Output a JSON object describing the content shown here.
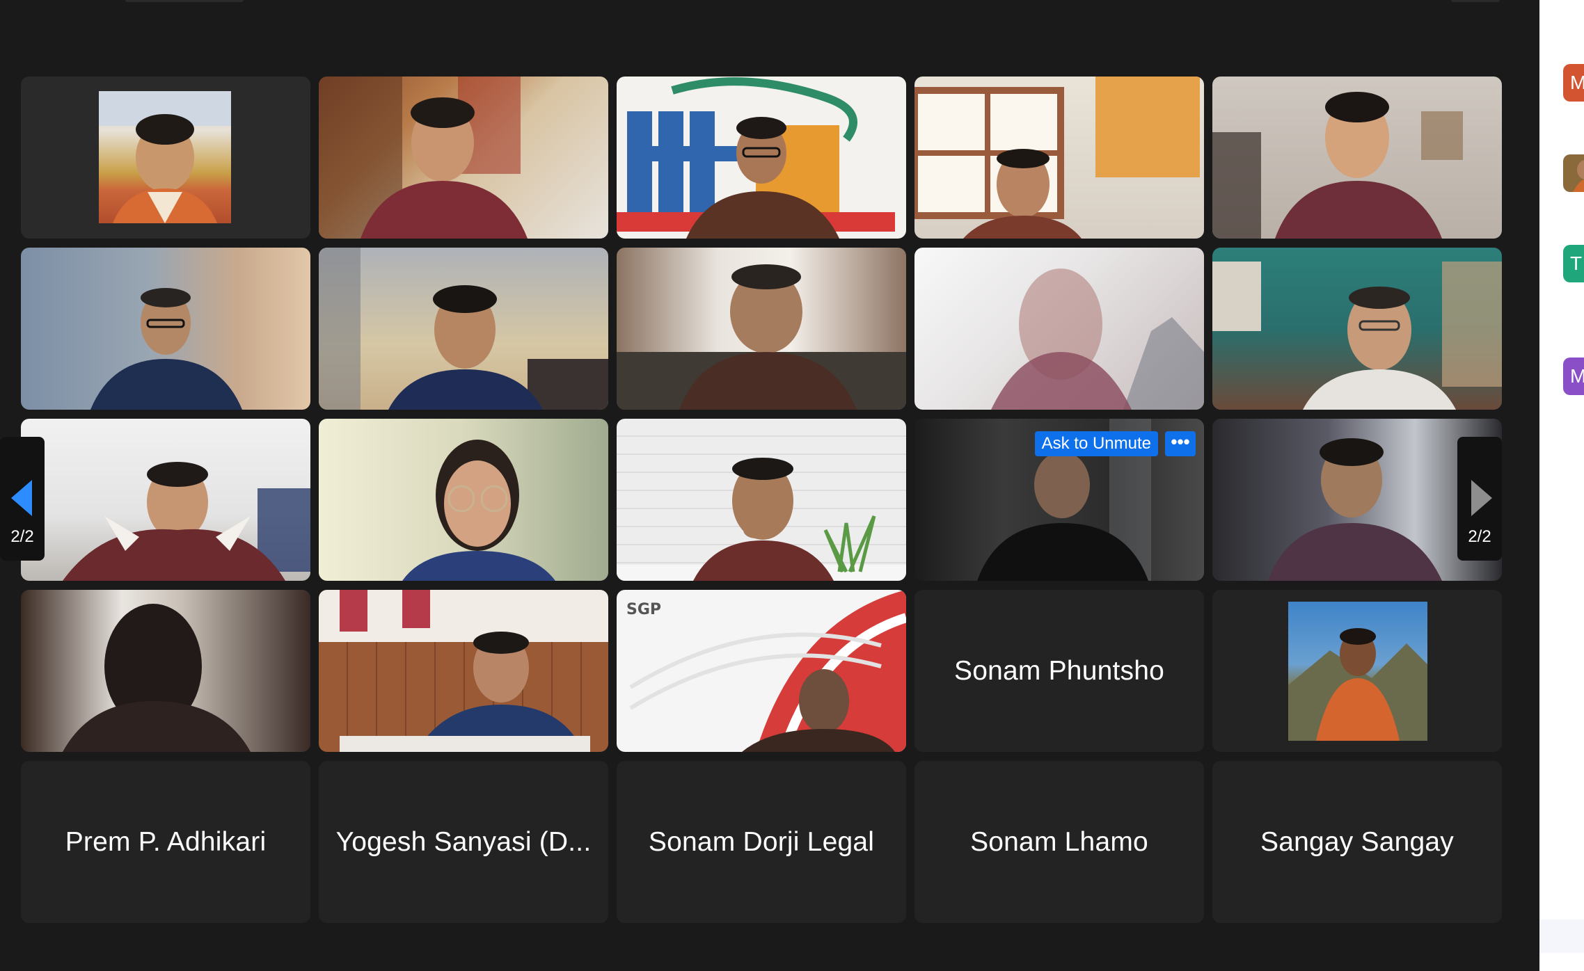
{
  "nav": {
    "prev_label": "2/2",
    "next_label": "2/2"
  },
  "tiles": {
    "ask_to_unmute": "Ask to Unmute",
    "more_label": "•••",
    "names": {
      "sonam_phuntsho": "Sonam Phuntsho",
      "prem": "Prem P. Adhikari",
      "yogesh": "Yogesh Sanyasi (D...",
      "sonam_dorji": "Sonam Dorji Legal",
      "sonam_lhamo": "Sonam Lhamo",
      "sangay": "Sangay Sangay"
    },
    "logo_text": "SGP"
  },
  "sidebar": {
    "avatars": [
      {
        "letter": "M",
        "color": "#d35431"
      },
      {
        "letter": "",
        "color": "#8a6a3a"
      },
      {
        "letter": "T",
        "color": "#1fa67a"
      },
      {
        "letter": "M",
        "color": "#8a4fc7"
      }
    ]
  },
  "colors": {
    "background": "#1a1a1a",
    "tile": "#232323",
    "accent": "#0e71eb",
    "nav_arrow_active": "#2d8cff",
    "nav_arrow_inactive": "#8e8e8e"
  }
}
